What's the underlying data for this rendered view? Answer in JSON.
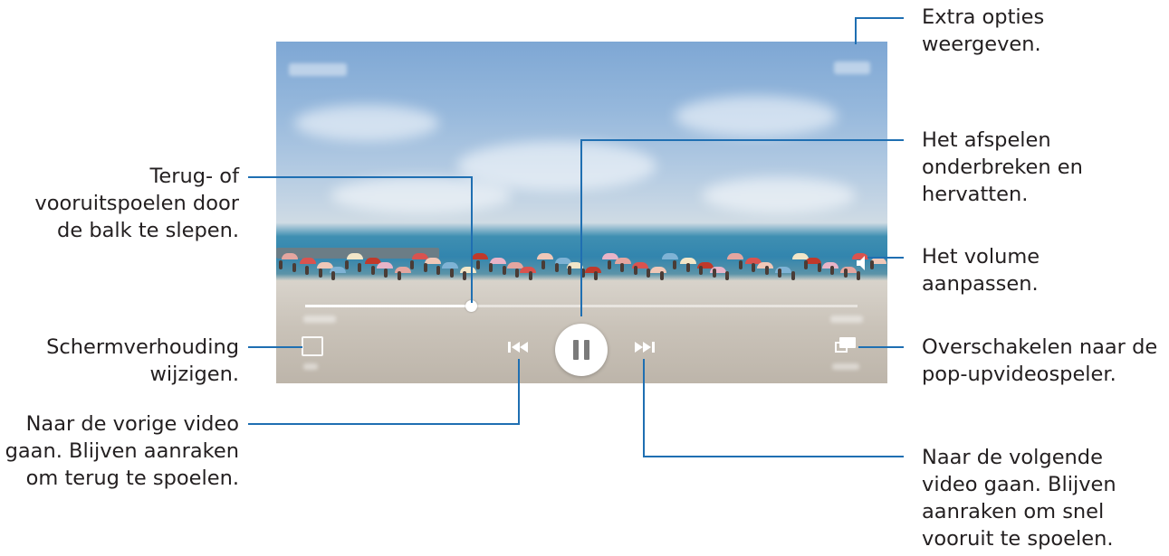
{
  "callouts": {
    "extra_options": [
      "Extra opties",
      "weergeven."
    ],
    "pause_resume": [
      "Het afspelen",
      "onderbreken en",
      "hervatten."
    ],
    "volume": [
      "Het volume",
      "aanpassen."
    ],
    "popup_player": [
      "Overschakelen naar de",
      "pop-upvideospeler."
    ],
    "next_video": [
      "Naar de volgende",
      "video gaan. Blijven",
      "aanraken om snel",
      "vooruit te spoelen."
    ],
    "seek": [
      "Terug- of",
      "vooruitspoelen door",
      "de balk te slepen."
    ],
    "aspect_ratio": [
      "Schermverhouding",
      "wijzigen."
    ],
    "previous_video": [
      "Naar de vorige video",
      "gaan. Blijven aanraken",
      "om terug te spoelen."
    ]
  },
  "player": {
    "progress": 0.3
  },
  "colors": {
    "callout_line": "#1f6fb2",
    "text": "#231f20"
  },
  "icons": [
    "pause-icon",
    "skip-previous-icon",
    "skip-next-icon",
    "aspect-ratio-icon",
    "popup-player-icon",
    "volume-icon",
    "more-options-icon"
  ]
}
